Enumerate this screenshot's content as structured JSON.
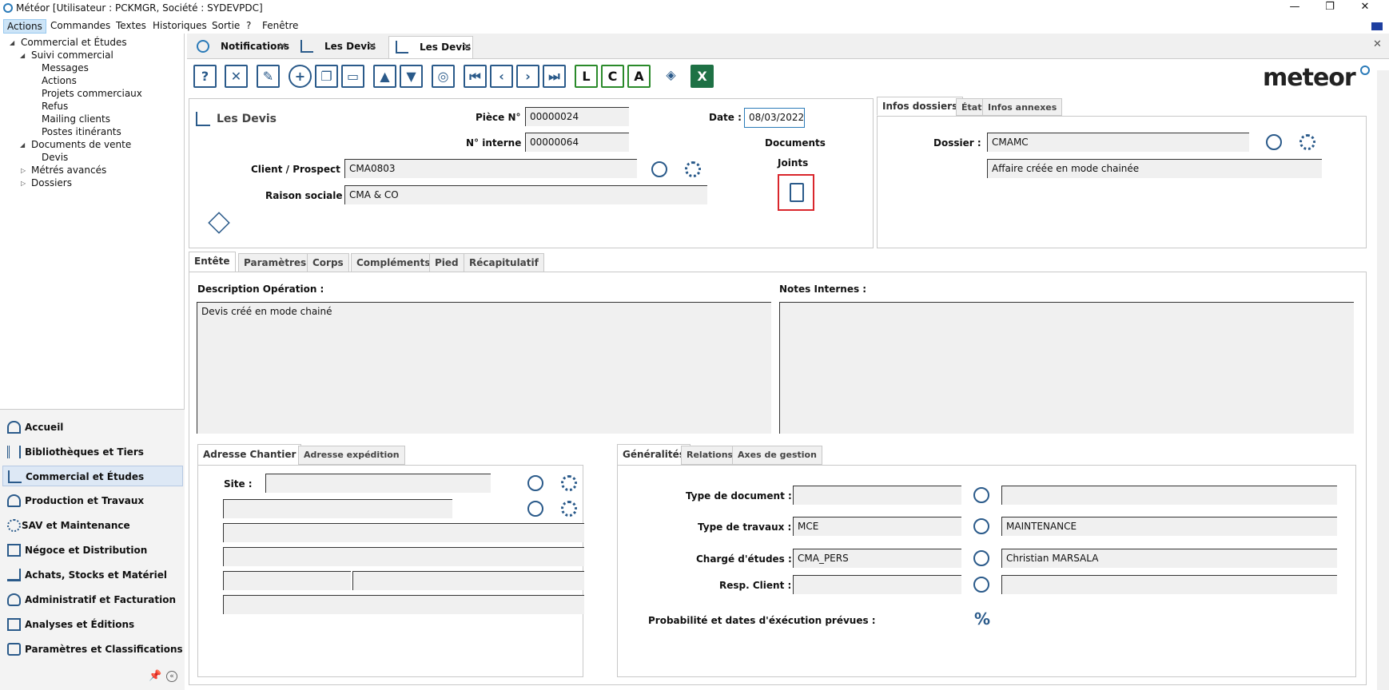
{
  "window": {
    "title": "Météor [Utilisateur : PCKMGR, Société : SYDEVPDC]",
    "minimize": "—",
    "restore": "❐",
    "close": "✕"
  },
  "menu": [
    "Actions",
    "Commandes",
    "Textes",
    "Historiques",
    "Sortie",
    "?",
    "Fenêtre"
  ],
  "tree": {
    "root": "Commercial et Études",
    "suivi": "Suivi commercial",
    "suivi_items": [
      "Messages",
      "Actions",
      "Projets commerciaux",
      "Refus",
      "Mailing clients",
      "Postes itinérants"
    ],
    "docs": "Documents de vente",
    "docs_items": [
      "Devis"
    ],
    "metres": "Métrés avancés",
    "dossiers": "Dossiers"
  },
  "nav": [
    "Accueil",
    "Bibliothèques et Tiers",
    "Commercial et Études",
    "Production et Travaux",
    "SAV et Maintenance",
    "Négoce et Distribution",
    "Achats, Stocks et Matériel",
    "Administratif et Facturation",
    "Analyses et Éditions",
    "Paramètres et Classifications"
  ],
  "doc_tabs": [
    "Notifications",
    "Les Devis",
    "Les Devis"
  ],
  "tab_close": "✕",
  "toolbar_glyphs": [
    "?",
    "✕",
    "✎",
    "+",
    "❐",
    "▭",
    "▲",
    "▼",
    "◎",
    "⏮",
    "‹",
    "›",
    "⏭",
    "L",
    "C",
    "A",
    "◈",
    "X"
  ],
  "brand": "meteor",
  "header": {
    "title": "Les Devis",
    "piece_label": "Pièce N° :",
    "piece_value": "00000024",
    "interne_label": "N° interne :",
    "interne_value": "00000064",
    "date_label": "Date :",
    "date_value": "08/03/2022",
    "docs_label_1": "Documents",
    "docs_label_2": "Joints",
    "client_label": "Client / Prospect :",
    "client_value": "CMA0803",
    "raison_label": "Raison sociale :",
    "raison_value": "CMA & CO"
  },
  "infos": {
    "tabs": [
      "Infos dossiers",
      "État",
      "Infos annexes"
    ],
    "dossier_label": "Dossier :",
    "dossier_value": "CMAMC",
    "dossier_desc": "Affaire créée en mode chainée"
  },
  "main_tabs": [
    "Entête",
    "Paramètres",
    "Corps",
    "Compléments",
    "Pied",
    "Récapitulatif"
  ],
  "entete": {
    "desc_label": "Description Opération :",
    "desc_value": "Devis créé en mode chainé",
    "notes_label": "Notes Internes :",
    "notes_value": ""
  },
  "adresse": {
    "tabs": [
      "Adresse Chantier",
      "Adresse expédition"
    ],
    "site_label": "Site :"
  },
  "generalites": {
    "tabs": [
      "Généralités",
      "Relations",
      "Axes de gestion"
    ],
    "type_doc_label": "Type de document :",
    "type_doc_value": "",
    "type_doc_desc": "",
    "type_trav_label": "Type de travaux :",
    "type_trav_value": "MCE",
    "type_trav_desc": "MAINTENANCE",
    "charge_label": "Chargé d'études :",
    "charge_value": "CMA_PERS",
    "charge_desc": "Christian MARSALA",
    "resp_label": "Resp. Client :",
    "resp_value": "",
    "resp_desc": "",
    "proba_label": "Probabilité et dates d'éxécution prévues :",
    "percent": "%"
  },
  "colors": {
    "accent": "#2a5a8a",
    "highlight": "#d9262c",
    "nav_sel": "#dde8f5"
  }
}
